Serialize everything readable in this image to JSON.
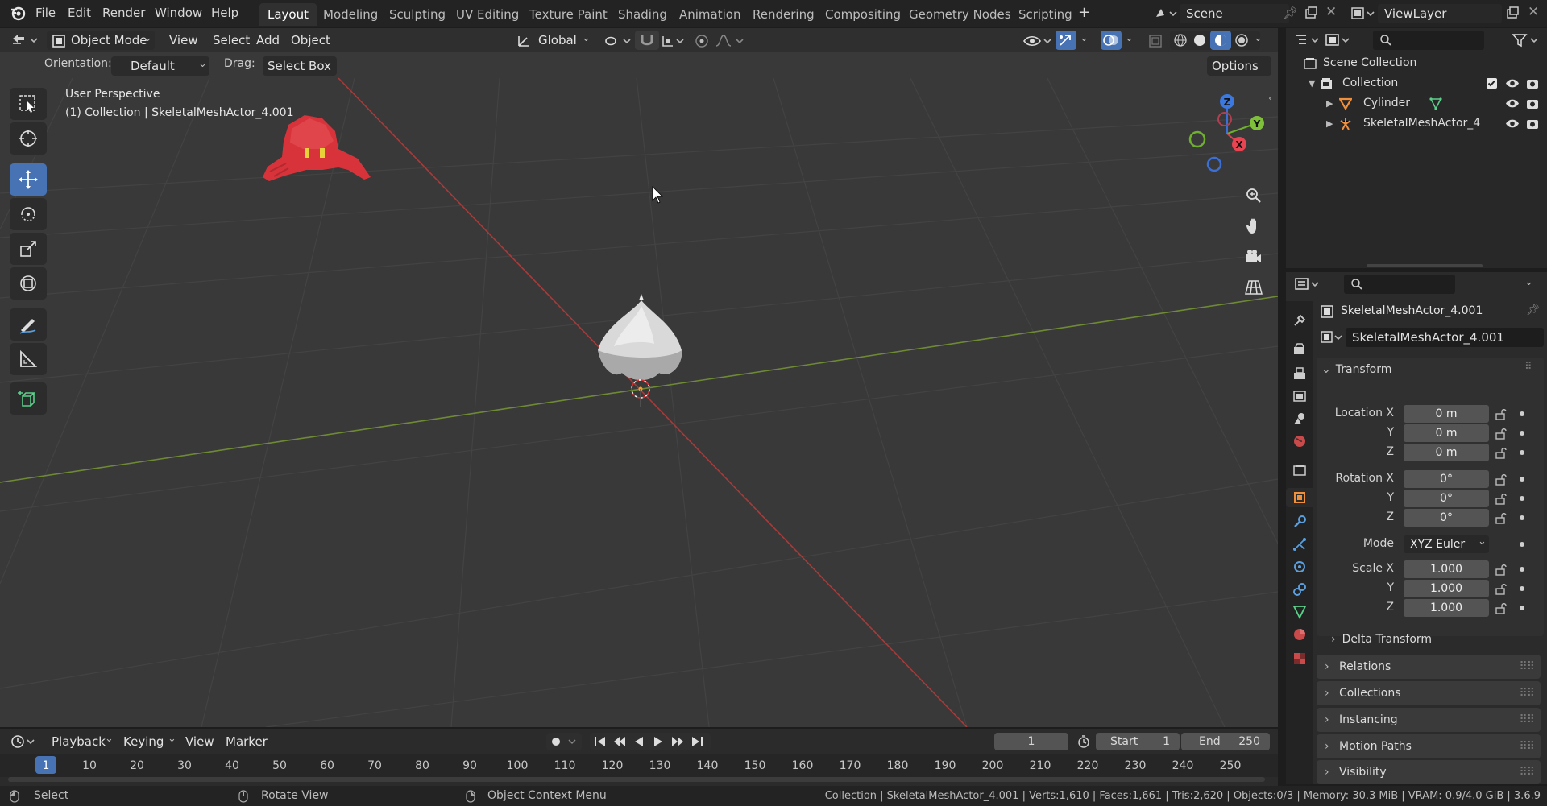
{
  "menu": [
    "File",
    "Edit",
    "Render",
    "Window",
    "Help"
  ],
  "workspaces": [
    "Layout",
    "Modeling",
    "Sculpting",
    "UV Editing",
    "Texture Paint",
    "Shading",
    "Animation",
    "Rendering",
    "Compositing",
    "Geometry Nodes",
    "Scripting"
  ],
  "add_workspace": "+",
  "scene_name": "Scene",
  "view_layer": "ViewLayer",
  "viewport": {
    "mode": "Object Mode",
    "menus": [
      "View",
      "Select",
      "Add",
      "Object"
    ],
    "transform_orientation": "Global",
    "orientation_label": "Orientation:",
    "orientation_value": "Default",
    "drag_label": "Drag:",
    "drag_value": "Select Box",
    "options": "Options",
    "perspective": "User Perspective",
    "active_info": "(1) Collection | SkeletalMeshActor_4.001",
    "gizmo": {
      "z": "Z",
      "y": "Y",
      "x": "X"
    }
  },
  "outliner": {
    "scene_collection": "Scene Collection",
    "collection": "Collection",
    "items": [
      "Cylinder",
      "SkeletalMeshActor_4"
    ]
  },
  "properties": {
    "object_name": "SkeletalMeshActor_4.001",
    "data_name": "SkeletalMeshActor_4.001",
    "transform_title": "Transform",
    "location_label": "Location X",
    "rotation_label": "Rotation X",
    "scale_label": "Scale X",
    "axis_y": "Y",
    "axis_z": "Z",
    "location": [
      "0 m",
      "0 m",
      "0 m"
    ],
    "rotation": [
      "0°",
      "0°",
      "0°"
    ],
    "mode_label": "Mode",
    "mode_value": "XYZ Euler",
    "scale": [
      "1.000",
      "1.000",
      "1.000"
    ],
    "delta": "Delta Transform",
    "panels": [
      "Relations",
      "Collections",
      "Instancing",
      "Motion Paths",
      "Visibility"
    ]
  },
  "timeline": {
    "menus": [
      "Playback",
      "Keying",
      "View",
      "Marker"
    ],
    "current_frame": "1",
    "start_label": "Start",
    "start": "1",
    "end_label": "End",
    "end": "250",
    "ruler": [
      "1",
      "10",
      "20",
      "30",
      "40",
      "50",
      "60",
      "70",
      "80",
      "90",
      "100",
      "110",
      "120",
      "130",
      "140",
      "150",
      "160",
      "170",
      "180",
      "190",
      "200",
      "210",
      "220",
      "230",
      "240",
      "250"
    ]
  },
  "status": {
    "select": "Select",
    "rotate": "Rotate View",
    "context": "Object Context Menu",
    "info": "Collection | SkeletalMeshActor_4.001 | Verts:1,610 | Faces:1,661 | Tris:2,620 | Objects:0/3 | Memory: 30.3 MiB | VRAM: 0.9/4.0 GiB | 3.6.9"
  }
}
